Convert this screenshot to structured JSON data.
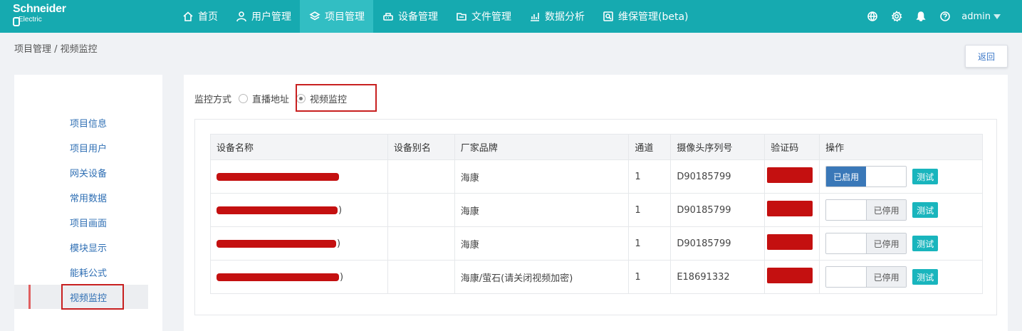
{
  "brand": {
    "line1": "Schneider",
    "line2": "Electric"
  },
  "nav": {
    "items": [
      {
        "label": "首页",
        "icon": "home-icon",
        "active": false
      },
      {
        "label": "用户管理",
        "icon": "user-icon",
        "active": false
      },
      {
        "label": "项目管理",
        "icon": "layers-icon",
        "active": true
      },
      {
        "label": "设备管理",
        "icon": "device-icon",
        "active": false
      },
      {
        "label": "文件管理",
        "icon": "folder-icon",
        "active": false
      },
      {
        "label": "数据分析",
        "icon": "bar-chart-icon",
        "active": false
      },
      {
        "label": "维保管理(beta)",
        "icon": "maintenance-icon",
        "active": false
      }
    ],
    "user": "admin",
    "accent": "#16aab0"
  },
  "breadcrumb": "项目管理 / 视频监控",
  "back_label": "返回",
  "sidebar": {
    "items": [
      {
        "label": "项目信息"
      },
      {
        "label": "项目用户"
      },
      {
        "label": "网关设备"
      },
      {
        "label": "常用数据"
      },
      {
        "label": "项目画面"
      },
      {
        "label": "模块显示"
      },
      {
        "label": "能耗公式"
      },
      {
        "label": "视频监控",
        "active": true
      }
    ]
  },
  "monitor": {
    "label": "监控方式",
    "options": [
      {
        "label": "直播地址",
        "checked": false
      },
      {
        "label": "视频监控",
        "checked": true
      }
    ]
  },
  "table": {
    "headers": [
      "设备名称",
      "设备别名",
      "厂家品牌",
      "通道",
      "摄像头序列号",
      "验证码",
      "操作"
    ],
    "rows": [
      {
        "alias": "",
        "brand": "海康",
        "channel": "1",
        "serial": "D90185799",
        "enabled": true,
        "suffix": ""
      },
      {
        "alias": "",
        "brand": "海康",
        "channel": "1",
        "serial": "D90185799",
        "enabled": false,
        "suffix": ")"
      },
      {
        "alias": "",
        "brand": "海康",
        "channel": "1",
        "serial": "D90185799",
        "enabled": false,
        "suffix": ")"
      },
      {
        "alias": "",
        "brand": "海康/萤石(请关闭视频加密)",
        "channel": "1",
        "serial": "E18691332",
        "enabled": false,
        "suffix": ")"
      }
    ],
    "enabled_label": "已启用",
    "disabled_label": "已停用",
    "test_label": "测试"
  }
}
